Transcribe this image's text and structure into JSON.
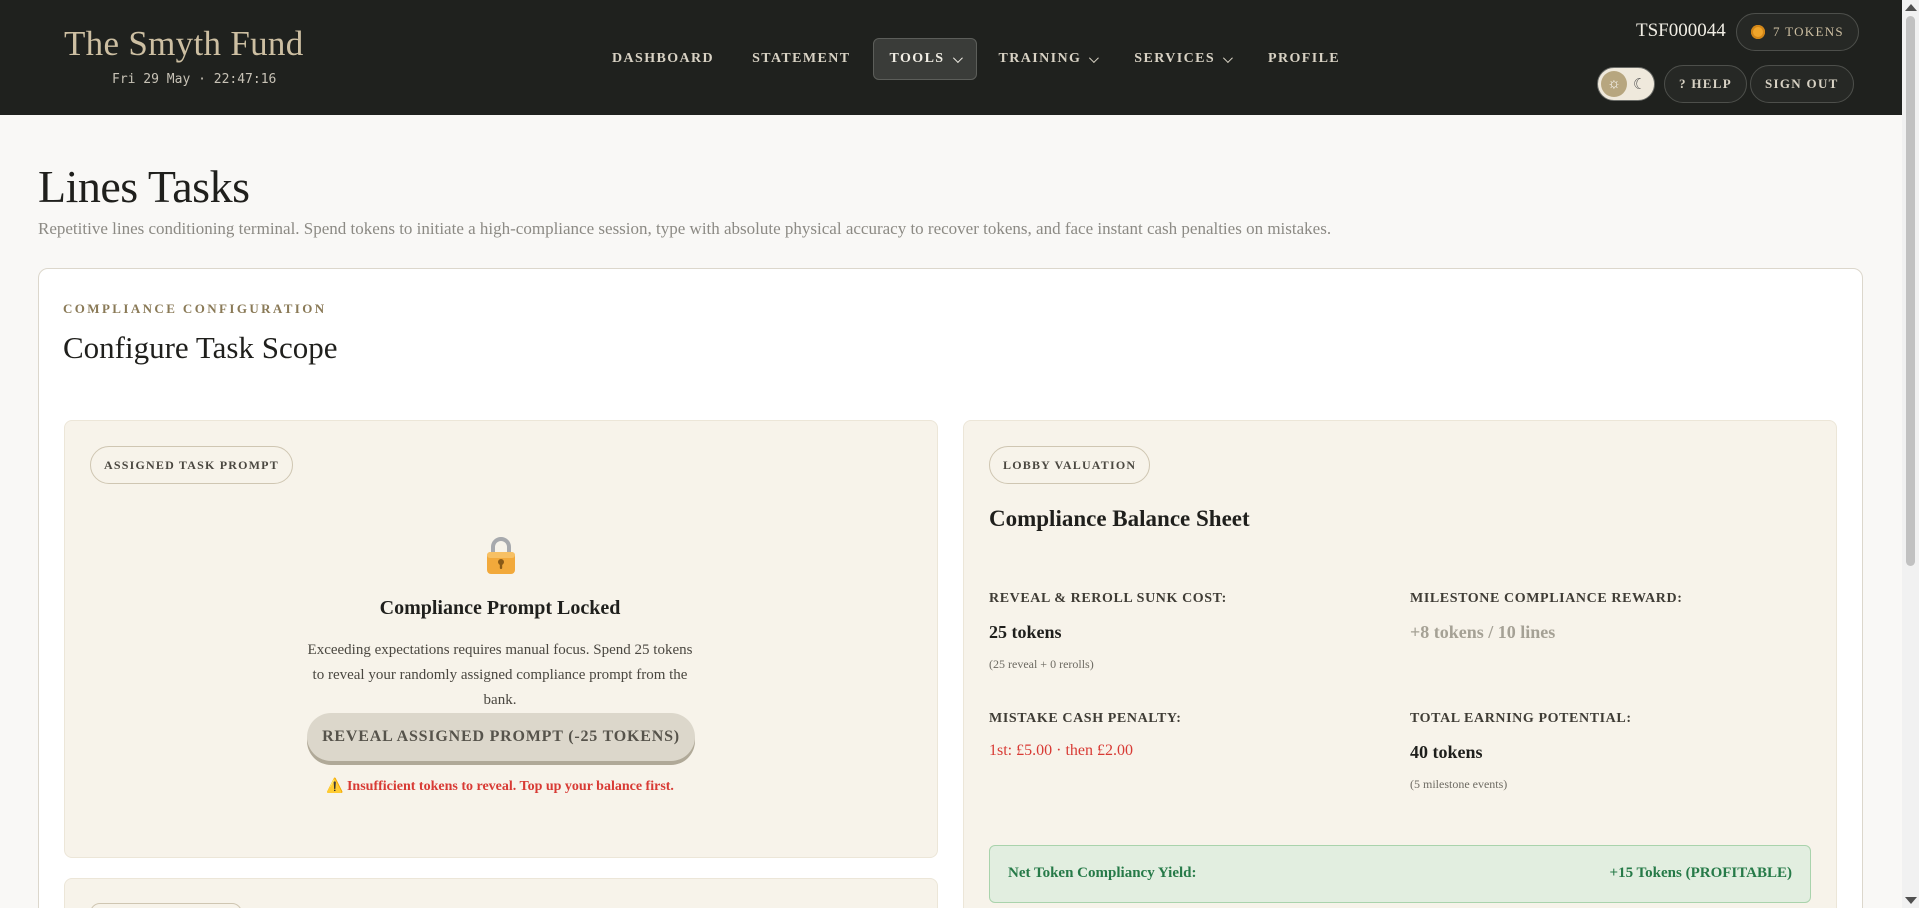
{
  "header": {
    "brand": "The Smyth Fund",
    "clock": "Fri 29 May · 22:47:16",
    "nav": [
      {
        "label": "DASHBOARD"
      },
      {
        "label": "STATEMENT"
      },
      {
        "label": "TOOLS"
      },
      {
        "label": "TRAINING"
      },
      {
        "label": "SERVICES"
      },
      {
        "label": "PROFILE"
      }
    ],
    "account_id": "TSF000044",
    "tokens": "7 TOKENS",
    "help_label": "? HELP",
    "signout_label": "SIGN OUT",
    "theme_sun": "☼",
    "theme_moon": "☾"
  },
  "page": {
    "title": "Lines Tasks",
    "subtitle": "Repetitive lines conditioning terminal. Spend tokens to initiate a high-compliance session, type with absolute physical accuracy to recover tokens, and face instant cash penalties on mistakes."
  },
  "config": {
    "eyebrow": "COMPLIANCE CONFIGURATION",
    "title": "Configure Task Scope"
  },
  "prompt_panel": {
    "tag": "ASSIGNED TASK PROMPT",
    "lock_title": "Compliance Prompt Locked",
    "lock_desc": "Exceeding expectations requires manual focus. Spend 25 tokens to reveal your randomly assigned compliance prompt from the bank.",
    "reveal_label": "REVEAL ASSIGNED PROMPT (-25 TOKENS)",
    "warning": "⚠️ Insufficient tokens to reveal. Top up your balance first."
  },
  "valuation": {
    "tag": "LOBBY VALUATION",
    "title": "Compliance Balance Sheet",
    "sunk_label": "REVEAL & REROLL SUNK COST:",
    "sunk_value": "25 tokens",
    "sunk_note": "(25 reveal + 0 rerolls)",
    "reward_label": "MILESTONE COMPLIANCE REWARD:",
    "reward_value": "+8 tokens / 10 lines",
    "penalty_label": "MISTAKE CASH PENALTY:",
    "penalty_value": "1st: £5.00 · then £2.00",
    "potential_label": "TOTAL EARNING POTENTIAL:",
    "potential_value": "40 tokens",
    "potential_note": "(5 milestone events)",
    "yield_label": "Net Token Compliancy Yield:",
    "yield_value": "+15 Tokens (PROFITABLE)"
  }
}
